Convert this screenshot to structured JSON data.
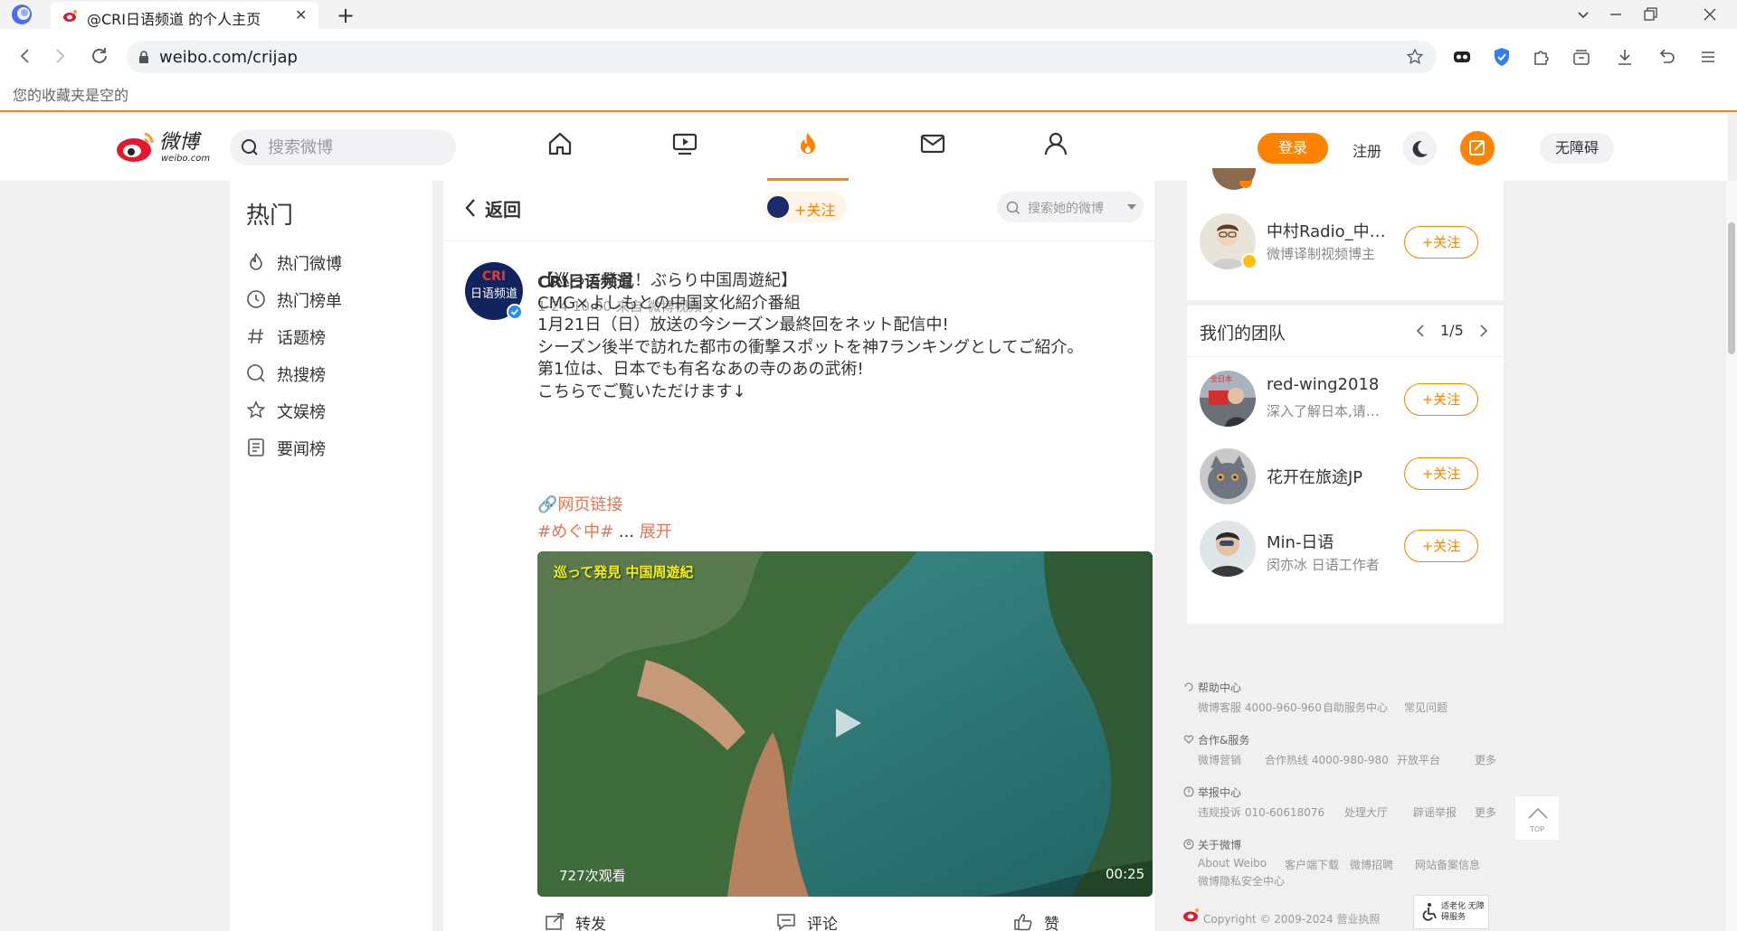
{
  "browser": {
    "tab_title": "@CRI日语频道 的个人主页",
    "url": "weibo.com/crijap",
    "bookmarks_empty": "您的收藏夹是空的"
  },
  "header": {
    "search_placeholder": "搜索微博",
    "login": "登录",
    "register": "注册",
    "accessibility": "无障碍"
  },
  "sidebar": {
    "title": "热门",
    "items": [
      {
        "label": "热门微博",
        "icon": "flame-icon"
      },
      {
        "label": "热门榜单",
        "icon": "clock-icon"
      },
      {
        "label": "话题榜",
        "icon": "hashtag-icon"
      },
      {
        "label": "热搜榜",
        "icon": "search-ring-icon"
      },
      {
        "label": "文娱榜",
        "icon": "star-icon"
      },
      {
        "label": "要闻榜",
        "icon": "news-icon"
      }
    ]
  },
  "main": {
    "back_label": "返回",
    "follow_label": "+关注",
    "post_search_placeholder": "搜索她的微博",
    "post": {
      "author": "CRI日语频道",
      "meta": "1-24 10:00  来自 微博视频号",
      "avatar_logo": "CRI",
      "avatar_text": "日语频道",
      "lines": [
        "【巡って発見！ぶらり中国周遊紀】",
        "CMG×よしもとの中国文化紹介番組",
        "1月21日（日）放送の今シーズン最終回をネット配信中!",
        "シーズン後半で訪れた都市の衝撃スポットを神7ランキングとしてご紹介。",
        "第1位は、日本でも有名なあの寺のあの武術!",
        "こちらでご覧いただけます↓"
      ],
      "web_link": "网页链接",
      "hashtag": "#めぐ中#",
      "ellipsis": " ... ",
      "expand": "展开",
      "video_watermark": "巡って発見 中国周遊紀",
      "video_views": "727次观看",
      "video_duration": "00:25",
      "actions": {
        "repost": "转发",
        "comment": "评论",
        "like": "赞"
      }
    }
  },
  "right": {
    "top_user": {
      "name": "中村Radio_中…",
      "desc": "微博译制视频博主",
      "follow": "+关注"
    },
    "team": {
      "title": "我们的团队",
      "page": "1/5",
      "members": [
        {
          "name": "red-wing2018",
          "desc": "深入了解日本,请…",
          "follow": "+关注"
        },
        {
          "name": "花开在旅途JP",
          "desc": "",
          "follow": "+关注"
        },
        {
          "name": "Min-日语",
          "desc": "闵亦冰 日语工作者",
          "follow": "+关注"
        }
      ]
    }
  },
  "footer": {
    "groups": [
      {
        "title": "帮助中心",
        "links": [
          "微博客服 4000-960-960",
          "自助服务中心",
          "常见问题"
        ]
      },
      {
        "title": "合作&服务",
        "links": [
          "微博营销",
          "合作热线 4000-980-980",
          "开放平台",
          "更多"
        ]
      },
      {
        "title": "举报中心",
        "links": [
          "违规投诉 010-60618076",
          "处理大厅",
          "辟谣举报",
          "更多"
        ]
      },
      {
        "title": "关于微博",
        "links": [
          "About Weibo",
          "客户端下载",
          "微博招聘",
          "网站备案信息"
        ]
      }
    ],
    "privacy": "微博隐私安全中心",
    "copyright": "Copyright © 2009-2024 营业执照",
    "to_top": "TOP",
    "elder_badge": "适老化 无障碍服务"
  },
  "colors": {
    "brand": "#ff8200",
    "link": "#eb7350",
    "verified": "#2d8cf0"
  }
}
